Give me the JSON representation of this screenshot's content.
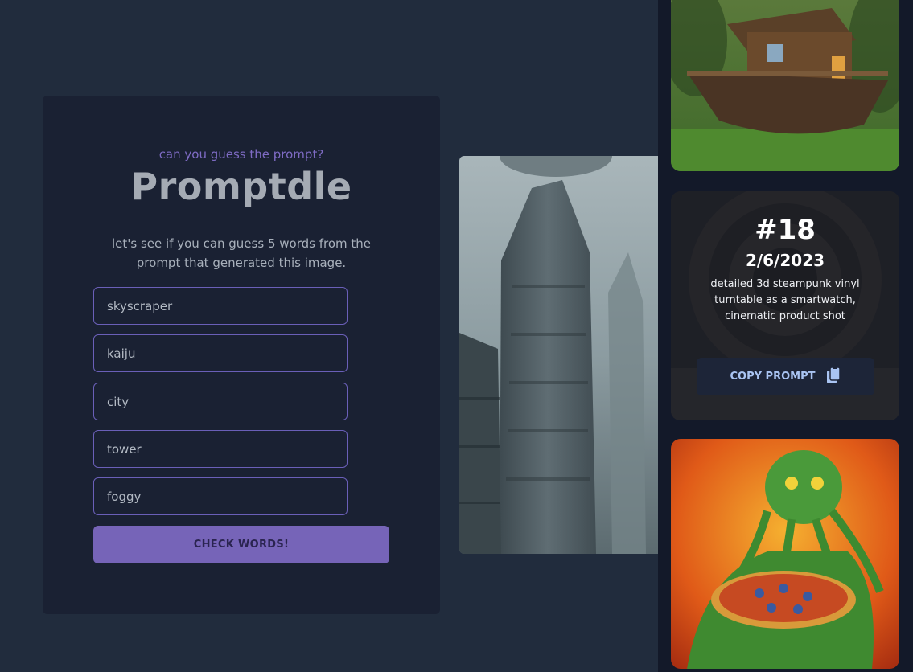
{
  "game": {
    "subtitle": "can you guess the prompt?",
    "title": "Promptdle",
    "description": "let's see if you can guess 5 words from the prompt that generated this image.",
    "words": [
      "skyscraper",
      "kaiju",
      "city",
      "tower",
      "foggy"
    ],
    "check_label": "CHECK WORDS!"
  },
  "main_image": {
    "subject": "foggy city skyscraper tower"
  },
  "sidebar": {
    "cards": [
      {
        "type": "image",
        "subject": "overgrown house ship in jungle"
      },
      {
        "type": "info",
        "number": "#18",
        "date": "2/6/2023",
        "prompt": "detailed 3d steampunk vinyl turntable as a smartwatch, cinematic product shot",
        "copy_label": "COPY PROMPT",
        "icon": "clipboard-icon"
      },
      {
        "type": "image",
        "subject": "cthulhu holding pizza"
      }
    ]
  },
  "colors": {
    "background": "#212c3d",
    "card": "#1a2133",
    "sidebar": "#131929",
    "accent": "#7664b8",
    "input_border": "#6a5fb8"
  }
}
